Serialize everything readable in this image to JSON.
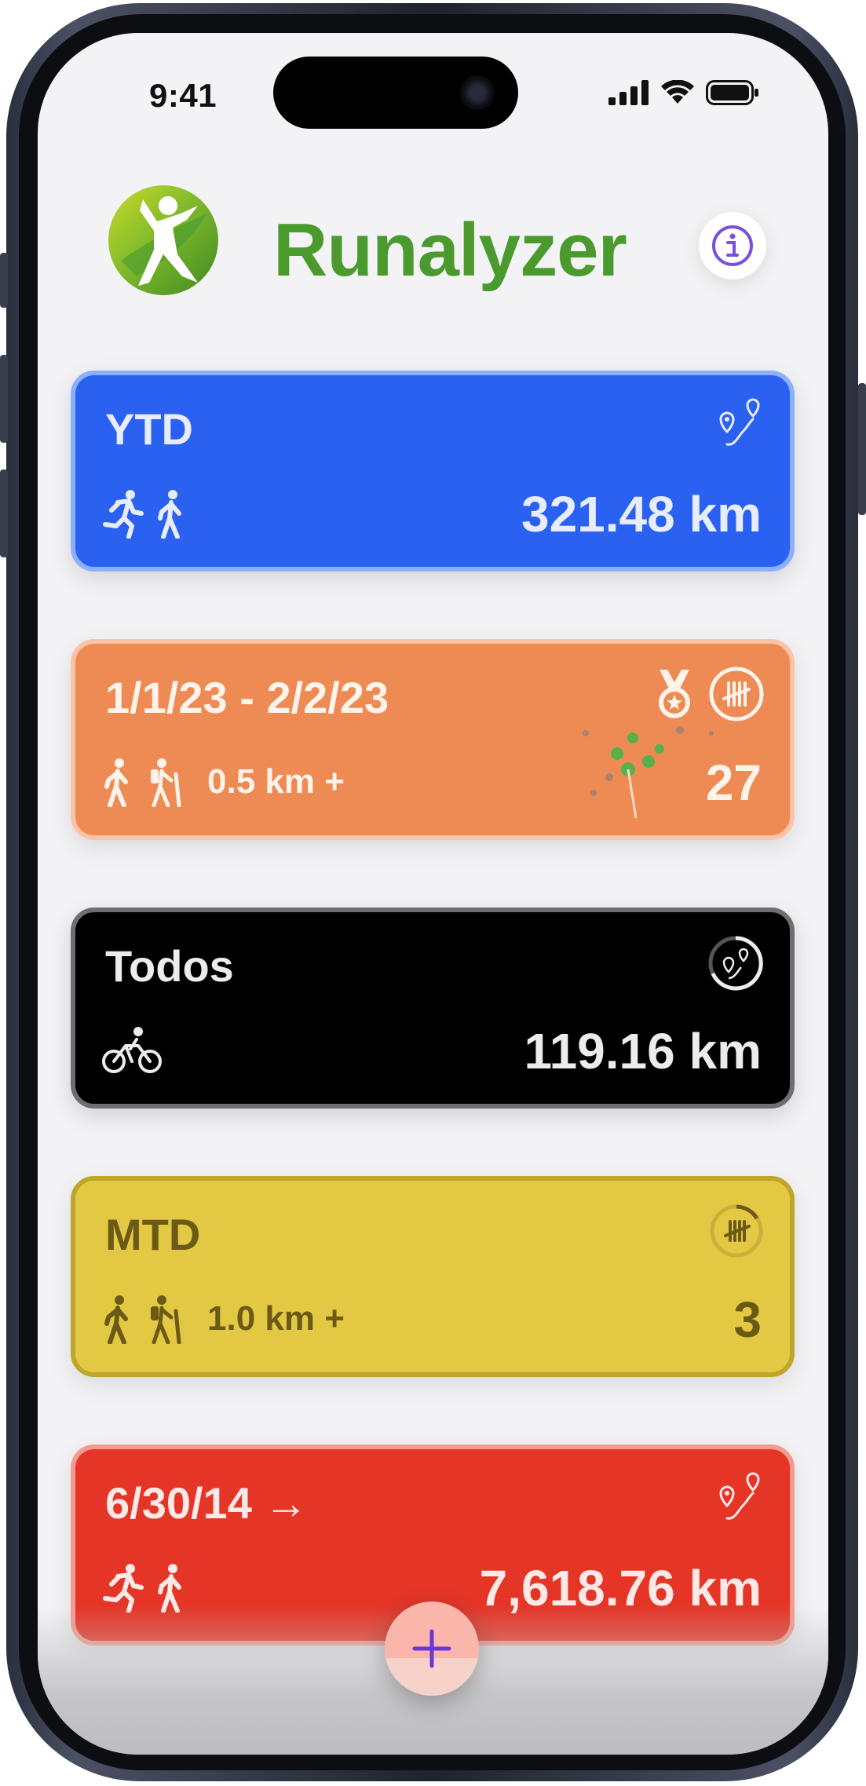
{
  "status_bar": {
    "time": "9:41"
  },
  "app": {
    "title": "Runalyzer",
    "logo_icon": "runner-leaf-logo",
    "info_icon": "info-icon"
  },
  "colors": {
    "brand_green": "#4a9a2e",
    "blue": "#2a61f0",
    "orange": "#ee8b55",
    "black": "#000000",
    "yellow": "#e3c843",
    "red": "#e43527",
    "info_purple": "#7a4fe0"
  },
  "cards": [
    {
      "title": "YTD",
      "value": "321.48 km",
      "filter": "",
      "activity_icons": [
        "running-icon",
        "walking-icon"
      ],
      "badge_icons": [
        "route-pins-icon"
      ]
    },
    {
      "title": "1/1/23 - 2/2/23",
      "value": "27",
      "filter": "0.5 km +",
      "activity_icons": [
        "walking-icon",
        "hiking-icon"
      ],
      "badge_icons": [
        "medal-icon",
        "tally-count-icon"
      ]
    },
    {
      "title": "Todos",
      "value": "119.16 km",
      "filter": "",
      "activity_icons": [
        "cycling-icon"
      ],
      "badge_icons": [
        "route-progress-icon"
      ]
    },
    {
      "title": "MTD",
      "value": "3",
      "filter": "1.0 km +",
      "activity_icons": [
        "walking-icon",
        "hiking-icon"
      ],
      "badge_icons": [
        "tally-progress-icon"
      ]
    },
    {
      "title": "6/30/14 →",
      "value": "7,618.76 km",
      "filter": "",
      "activity_icons": [
        "running-icon",
        "walking-icon"
      ],
      "badge_icons": [
        "route-pins-icon"
      ]
    }
  ],
  "fab": {
    "icon": "plus-icon"
  }
}
